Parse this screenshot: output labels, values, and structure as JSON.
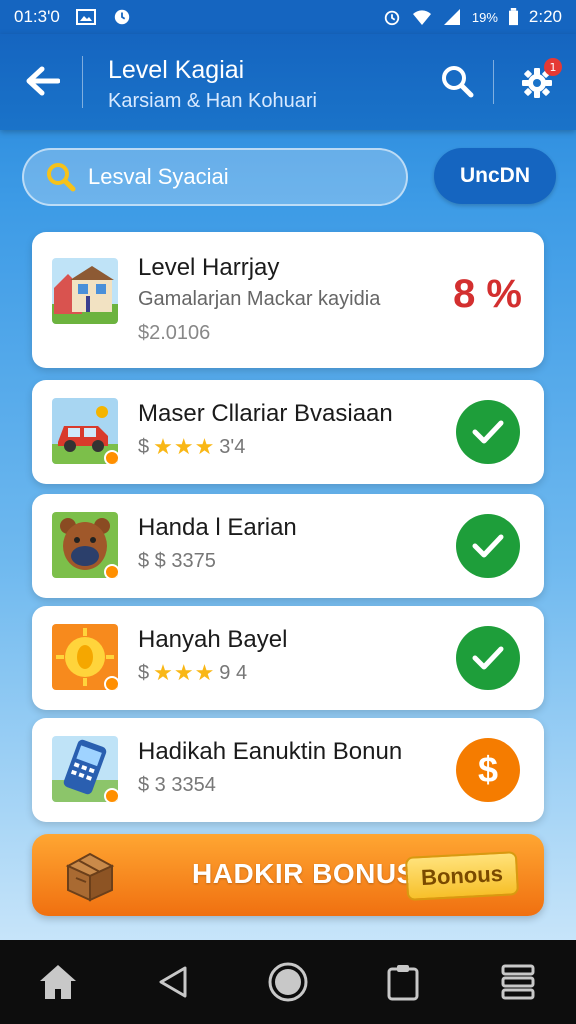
{
  "status_bar": {
    "left_time": "01:3'0",
    "battery_pct": "19%",
    "time": "2:20"
  },
  "app_bar": {
    "title": "Level Kagiai",
    "subtitle": "Karsiam & Han Kohuari",
    "notification_count": "1"
  },
  "search": {
    "placeholder": "Lesval Syaciai",
    "unlock_label": "UncDN"
  },
  "items": [
    {
      "title": "Level Harrjay",
      "subtitle": "Gamalarjan Mackar kayidia",
      "price": "$2.0106",
      "percent": "8 %",
      "icon": "town-icon"
    },
    {
      "title": "Maser Cllariar Bvasiaan",
      "price": "$",
      "rating": "3'4",
      "stars": "★★★",
      "status": "completed",
      "icon": "car-icon"
    },
    {
      "title": "Handa l Earian",
      "price": "$ $ 3375",
      "status": "completed",
      "icon": "bear-icon"
    },
    {
      "title": "Hanyah Bayel",
      "price": "$",
      "rating": "9 4",
      "stars": "★★★",
      "status": "completed",
      "icon": "sun-icon"
    },
    {
      "title": "Hadikah Eanuktin Bonun",
      "price": "$ 3 3354",
      "action": "$",
      "icon": "phone-icon"
    }
  ],
  "bonus": {
    "label": "HADKIR BONUS",
    "tag": "Bonous"
  },
  "colors": {
    "primary": "#1565c0",
    "success": "#1e9e3a",
    "accent": "#f57c00",
    "danger": "#d32f2f"
  }
}
